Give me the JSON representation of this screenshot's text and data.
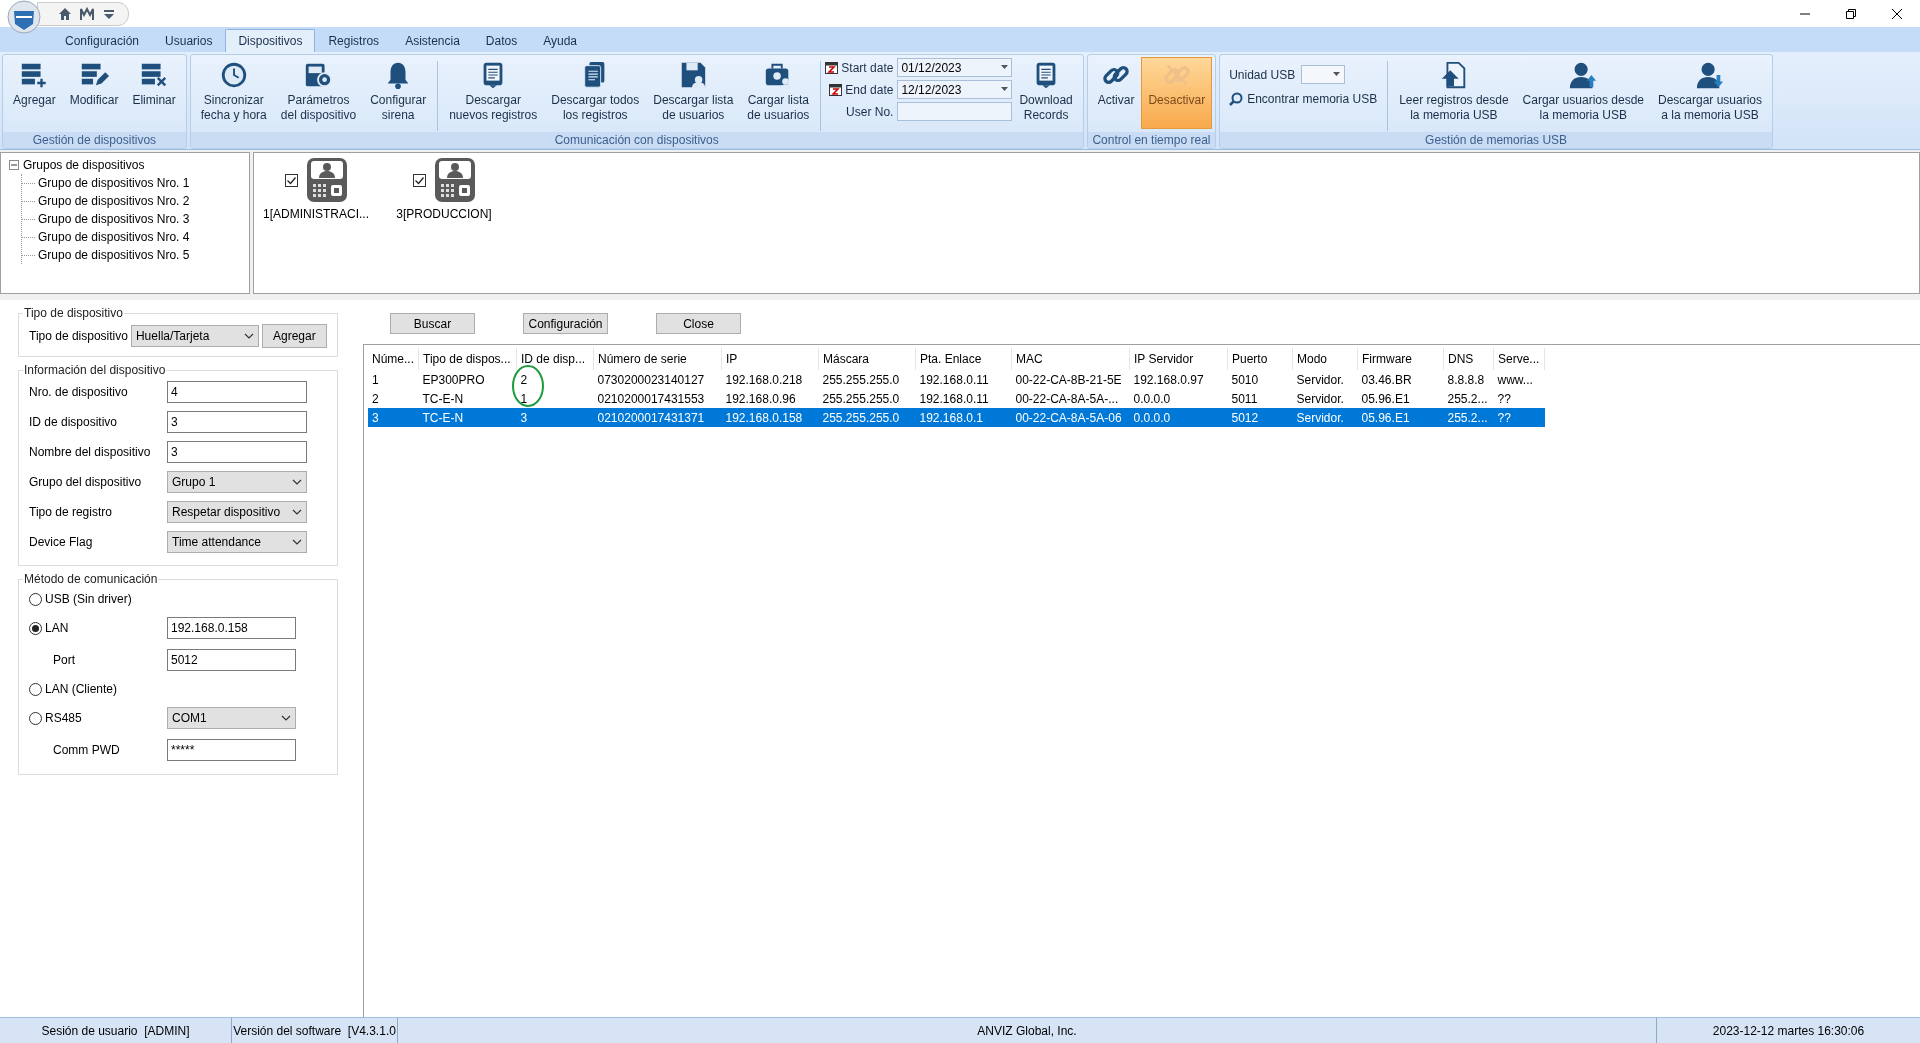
{
  "menu_tabs": [
    {
      "label": "Configuración",
      "selected": false
    },
    {
      "label": "Usuarios",
      "selected": false
    },
    {
      "label": "Dispositivos",
      "selected": true
    },
    {
      "label": "Registros",
      "selected": false
    },
    {
      "label": "Asistencia",
      "selected": false
    },
    {
      "label": "Datos",
      "selected": false
    },
    {
      "label": "Ayuda",
      "selected": false
    }
  ],
  "ribbon": {
    "groups": [
      {
        "title": "Gestión de dispositivos",
        "items": [
          {
            "kind": "button",
            "label": "Agregar"
          },
          {
            "kind": "button",
            "label": "Modificar"
          },
          {
            "kind": "button",
            "label": "Eliminar"
          }
        ]
      },
      {
        "title": "Comunicación con dispositivos",
        "items": [
          {
            "kind": "button",
            "label": "Sincronizar\nfecha y hora"
          },
          {
            "kind": "button",
            "label": "Parámetros\ndel dispositivo"
          },
          {
            "kind": "button",
            "label": "Configurar\nsirena"
          },
          {
            "kind": "separator"
          },
          {
            "kind": "button",
            "label": "Descargar\nnuevos registros"
          },
          {
            "kind": "button",
            "label": "Descargar todos\nlos registros"
          },
          {
            "kind": "button",
            "label": "Descargar lista\nde usuarios"
          },
          {
            "kind": "button",
            "label": "Cargar lista\nde usuarios"
          },
          {
            "kind": "separator"
          },
          {
            "kind": "dates",
            "fields": [
              {
                "label": "Start date",
                "value": "01/12/2023",
                "calendar": true
              },
              {
                "label": "End date",
                "value": "12/12/2023",
                "calendar": true
              },
              {
                "label": "User No.",
                "calendar": false
              }
            ]
          },
          {
            "kind": "button",
            "label": "Download\nRecords"
          }
        ]
      },
      {
        "title": "Control en tiempo real",
        "items": [
          {
            "kind": "button",
            "label": "Activar",
            "pressed": false,
            "disabled": false
          },
          {
            "kind": "button",
            "label": "Desactivar",
            "pressed": true,
            "disabled": true
          }
        ]
      },
      {
        "title": "Gestión de memorias USB",
        "items": [
          {
            "kind": "usb",
            "label": "Unidad USB",
            "link": "Encontrar memoria USB"
          },
          {
            "kind": "separator"
          },
          {
            "kind": "button",
            "label": "Leer registros desde\nla memoria USB"
          },
          {
            "kind": "button",
            "label": "Cargar usuarios desde\nla memoria USB"
          },
          {
            "kind": "button",
            "label": "Descargar usuarios\na la memoria USB"
          }
        ]
      }
    ]
  },
  "tree": {
    "label": "Grupos de dispositivos",
    "expanded": true,
    "children": [
      {
        "label": "Grupo de dispositivos Nro. 1"
      },
      {
        "label": "Grupo de dispositivos Nro. 2"
      },
      {
        "label": "Grupo de dispositivos Nro. 3"
      },
      {
        "label": "Grupo de dispositivos Nro. 4"
      },
      {
        "label": "Grupo de dispositivos Nro. 5"
      }
    ]
  },
  "devices": [
    {
      "label": "1[ADMINISTRACI...",
      "checked": true
    },
    {
      "label": "3[PRODUCCION]",
      "checked": true
    }
  ],
  "device_type": {
    "title": "Tipo de dispositivo",
    "label": "Tipo de dispositivo",
    "value": "Huella/Tarjeta",
    "button": "Agregar"
  },
  "device_info": {
    "title": "Información del dispositivo",
    "fields": [
      {
        "kind": "text",
        "label": "Nro. de dispositivo",
        "value": "4"
      },
      {
        "kind": "text",
        "label": "ID de dispositivo",
        "value": "3"
      },
      {
        "kind": "text",
        "label": "Nombre del dispositivo",
        "value": "3"
      },
      {
        "kind": "select",
        "label": "Grupo del dispositivo",
        "value": "Grupo 1"
      },
      {
        "kind": "select",
        "label": "Tipo de registro",
        "value": "Respetar dispositivo"
      },
      {
        "kind": "select",
        "label": "Device Flag",
        "value": "Time attendance"
      }
    ]
  },
  "communication": {
    "title": "Método de comunicación",
    "rows": [
      {
        "kind": "radio",
        "label": "USB (Sin driver)",
        "selected": false
      },
      {
        "kind": "radio_text",
        "label": "LAN",
        "selected": true,
        "value": "192.168.0.158"
      },
      {
        "kind": "text",
        "label": "Port",
        "value": "5012"
      },
      {
        "kind": "radio",
        "label": "LAN (Cliente)",
        "selected": false
      },
      {
        "kind": "radio_select",
        "label": "RS485",
        "selected": false,
        "value": "COM1"
      },
      {
        "kind": "text",
        "label": "Comm PWD",
        "value": "*****"
      }
    ]
  },
  "actions": [
    "Buscar",
    "Configuración",
    "Close"
  ],
  "table": {
    "columns": [
      "Núme...",
      "Tipo de dispos...",
      "ID de disp...",
      "Número de serie",
      "IP",
      "Máscara",
      "Pta. Enlace",
      "MAC",
      "IP Servidor",
      "Puerto",
      "Modo",
      "Firmware",
      "DNS",
      "Serve..."
    ],
    "rows": [
      {
        "selected": false,
        "cells": [
          "1",
          "EP300PRO",
          "2",
          "0730200023140127",
          "192.168.0.218",
          "255.255.255.0",
          "192.168.0.11",
          "00-22-CA-8B-21-5E",
          "192.168.0.97",
          "5010",
          "Servidor.",
          "03.46.BR",
          "8.8.8.8",
          "www..."
        ]
      },
      {
        "selected": false,
        "cells": [
          "2",
          "TC-E-N",
          "1",
          "0210200017431553",
          "192.168.0.96",
          "255.255.255.0",
          "192.168.0.11",
          "00-22-CA-8A-5A-...",
          "0.0.0.0",
          "5011",
          "Servidor.",
          "05.96.E1",
          "255.2...",
          "??"
        ]
      },
      {
        "selected": true,
        "cells": [
          "3",
          "TC-E-N",
          "3",
          "0210200017431371",
          "192.168.0.158",
          "255.255.255.0",
          "192.168.0.1",
          "00-22-CA-8A-5A-06",
          "0.0.0.0",
          "5012",
          "Servidor.",
          "05.96.E1",
          "255.2...",
          "??"
        ]
      }
    ]
  },
  "status_bar": [
    "Sesión de usuario  [ADMIN]",
    "Versión del software  [V4.3.1.0",
    "ANVIZ Global, Inc.",
    "2023-12-12 martes 16:30:06"
  ]
}
